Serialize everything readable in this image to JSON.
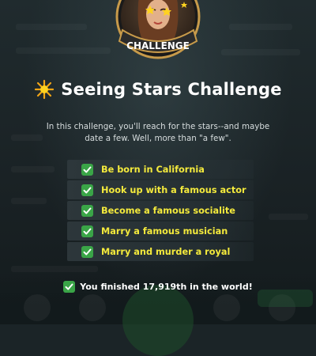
{
  "badge": {
    "label": "CHALLENGE",
    "icon": "challenge-badge-icon"
  },
  "title_icon": "sparkle-star-icon",
  "title": "Seeing Stars Challenge",
  "description": "In this challenge, you'll reach for the stars--and maybe date a few. Well, more than \"a few\".",
  "goals": [
    {
      "label": "Be born in California",
      "completed": true
    },
    {
      "label": "Hook up with a famous actor",
      "completed": true
    },
    {
      "label": "Become a famous socialite",
      "completed": true
    },
    {
      "label": "Marry a famous musician",
      "completed": true
    },
    {
      "label": "Marry and murder a royal",
      "completed": true
    }
  ],
  "result": {
    "icon": "check-icon",
    "text": "You finished 17,919th in the world!"
  },
  "colors": {
    "goal_text": "#f4ea3c",
    "check_bg": "#3aa547",
    "background": "#1b2427"
  }
}
